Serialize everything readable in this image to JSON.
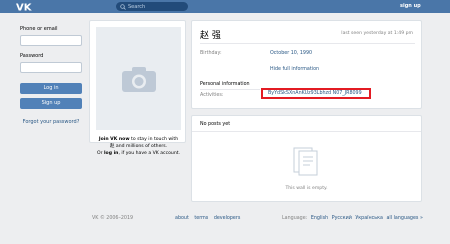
{
  "header": {
    "search_placeholder": "Search",
    "signup_label": "sign up"
  },
  "login": {
    "phone_label": "Phone or email",
    "password_label": "Password",
    "login_button": "Log in",
    "signup_button": "Sign up",
    "forgot_link": "Forgot your password?"
  },
  "photo_card": {
    "join_line1_bold": "Join VK now",
    "join_line1_rest": " to stay in touch with",
    "join_line2": "赵 and millions of others.",
    "join_line3_pre": "Or ",
    "join_line3_bold": "log in",
    "join_line3_rest": ", if you have a VK account."
  },
  "profile": {
    "name": "赵 强",
    "last_seen": "last seen yesterday at 1:49 pm",
    "birthday_label": "Birthday:",
    "birthday_value": "October 10, 1990",
    "hide_info_link": "Hide full information",
    "personal_info_title": "Personal information",
    "activities_label": "Activities:",
    "activities_value": "ByYdSkSXnAnKUz93Lbhzd N07_JR8099"
  },
  "posts": {
    "tab_label": "No posts yet",
    "empty_text": "This wall is empty."
  },
  "footer": {
    "copyright": "VK © 2006–2019",
    "link_about": "about",
    "link_terms": "terms",
    "link_developers": "developers",
    "language_label": "Language:",
    "lang_en": "English",
    "lang_ru": "Русский",
    "lang_ua": "Українська",
    "lang_all": "all languages »"
  },
  "colors": {
    "header_bg": "#4a76a8",
    "link": "#2a5885",
    "button": "#5181b8",
    "highlight_border": "#e31b23"
  }
}
